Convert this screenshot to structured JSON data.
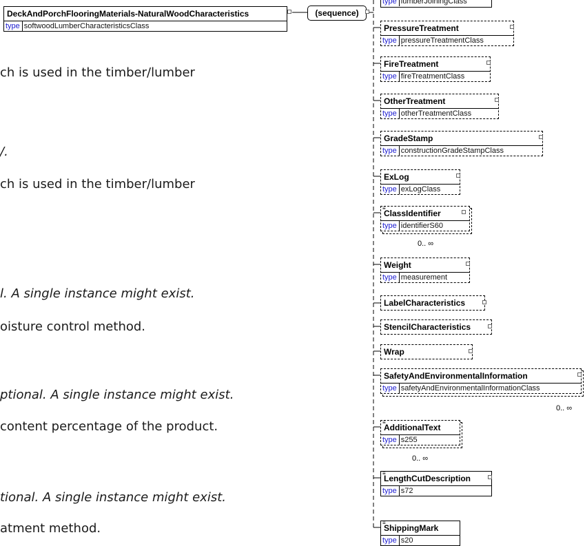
{
  "root": {
    "name": "DeckAndPorchFlooringMaterials-NaturalWoodCharacteristics",
    "type_key": "type",
    "type_value": "softwoodLumberCharacteristicsClass"
  },
  "sequence_label": "(sequence)",
  "text_lines": [
    "ch is used in the timber/lumber",
    "/.",
    "ch is used in the timber/lumber",
    "l. A single instance might exist.",
    "oisture control method.",
    "ptional. A single instance might exist.",
    "content percentage of the product.",
    "tional. A single instance might exist.",
    "atment method."
  ],
  "elements": [
    {
      "name": "",
      "type_key": "type",
      "type_value": "lumberJoiningClass"
    },
    {
      "name": "PressureTreatment",
      "type_key": "type",
      "type_value": "pressureTreatmentClass"
    },
    {
      "name": "FireTreatment",
      "type_key": "type",
      "type_value": "fireTreatmentClass"
    },
    {
      "name": "OtherTreatment",
      "type_key": "type",
      "type_value": "otherTreatmentClass"
    },
    {
      "name": "GradeStamp",
      "type_key": "type",
      "type_value": "constructionGradeStampClass"
    },
    {
      "name": "ExLog",
      "type_key": "type",
      "type_value": "exLogClass"
    },
    {
      "name": "ClassIdentifier",
      "type_key": "type",
      "type_value": "identifierS60",
      "cardinality": "0.. ∞"
    },
    {
      "name": "Weight",
      "type_key": "type",
      "type_value": "measurement"
    },
    {
      "name": "LabelCharacteristics"
    },
    {
      "name": "StencilCharacteristics"
    },
    {
      "name": "Wrap"
    },
    {
      "name": "SafetyAndEnvironmentalInformation",
      "type_key": "type",
      "type_value": "safetyAndEnvironmentalInformationClass",
      "cardinality": "0.. ∞"
    },
    {
      "name": "AdditionalText",
      "type_key": "type",
      "type_value": "s255",
      "cardinality": "0.. ∞"
    },
    {
      "name": "LengthCutDescription",
      "type_key": "type",
      "type_value": "s72"
    },
    {
      "name": "ShippingMark",
      "type_key": "type",
      "type_value": "s20"
    }
  ]
}
